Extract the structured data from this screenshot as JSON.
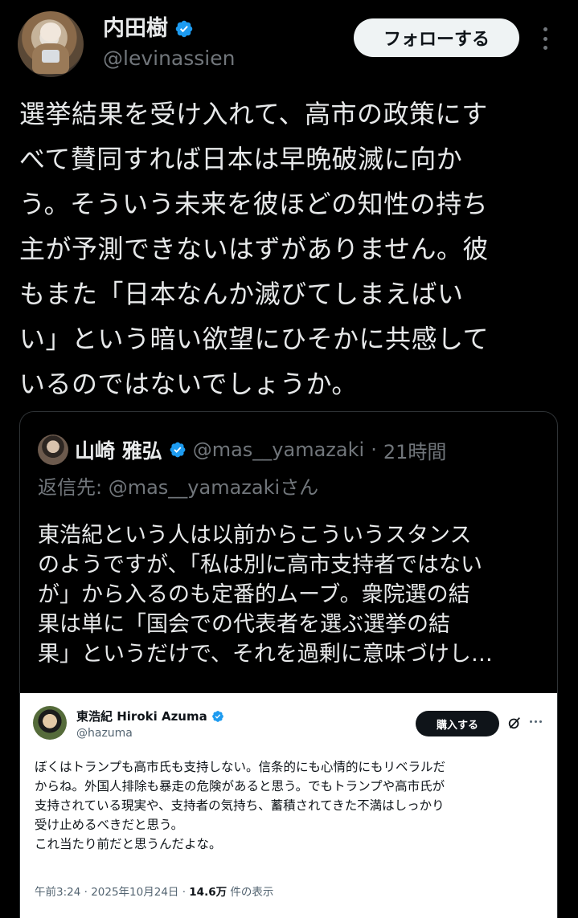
{
  "author": {
    "display_name": "内田樹",
    "handle": "@levinassien",
    "verified_icon": "verified-badge-icon",
    "follow_label": "フォローする",
    "more_icon": "more-vertical-icon"
  },
  "tweet": {
    "lines": [
      "選挙結果を受け入れて、高市の政策にす",
      "べて賛同すれば日本は早晩破滅に向か",
      "う。そういう未来を彼ほどの知性の持ち",
      "主が予測できないはずがありません。彼",
      "もまた「日本なんか滅びてしまえばい",
      "い」という暗い欲望にひそかに共感して",
      "いるのではないでしょうか。"
    ]
  },
  "quote": {
    "display_name": "山崎 雅弘",
    "handle": "@mas__yamazaki",
    "separator": "·",
    "time": "21時間",
    "reply_prefix": "返信先: ",
    "reply_to": "@mas__yamazaki",
    "reply_suffix": "さん",
    "lines": [
      "東浩紀という人は以前からこういうスタンス",
      "のようですが、「私は別に高市支持者ではない",
      "が」から入るのも定番的ムーブ。衆院選の結",
      "果は単に「国会での代表者を選ぶ選挙の結",
      "果」というだけで、それを過剰に意味づけし…"
    ],
    "embed": {
      "display_name": "東浩紀 Hiroki Azuma",
      "handle": "@hazuma",
      "buy_label": "購入する",
      "lines": [
        "ぼくはトランプも高市氏も支持しない。信条的にも心情的にもリベラルだ",
        "からね。外国人排除も暴走の危険があると思う。でもトランプや高市氏が",
        "支持されている現実や、支持者の気持ち、蓄積されてきた不満はしっかり",
        "受け止めるべきだと思う。",
        "これ当たり前だと思うんだよな。"
      ],
      "timestamp": "午前3:24 · 2025年10月24日 · ",
      "views_count": "14.6万",
      "views_label": " 件の表示"
    }
  },
  "colors": {
    "background": "#000000",
    "text": "#e7e9ea",
    "muted": "#71767b",
    "verified_blue": "#1d9bf0",
    "border": "#2f3336"
  }
}
